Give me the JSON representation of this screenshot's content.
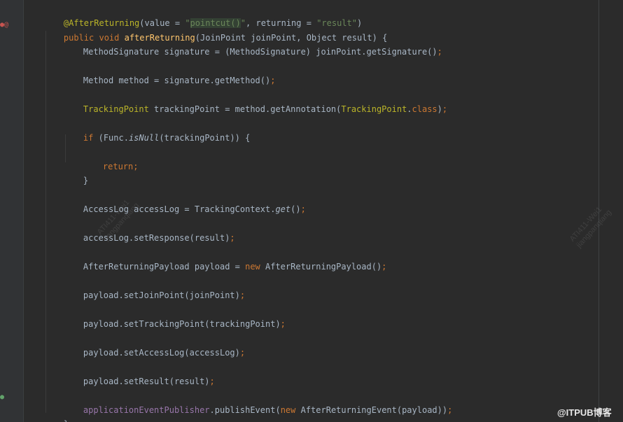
{
  "gutter": {
    "line2_icons": "●@",
    "line_last_icon": "●"
  },
  "code": {
    "l1": {
      "a": "@AfterReturning",
      "b": "(value = ",
      "c": "\"",
      "d": "pointcut()",
      "e": "\"",
      "f": ", returning = ",
      "g": "\"result\"",
      "h": ")"
    },
    "l2": {
      "a": "public ",
      "b": "void ",
      "c": "afterReturning",
      "d": "(JoinPoint joinPoint, Object result) {"
    },
    "l3": {
      "a": "MethodSignature signature = (MethodSignature) joinPoint.getSignature()",
      "b": ";"
    },
    "l4": {
      "a": "Method method = signature.getMethod()",
      "b": ";"
    },
    "l5": {
      "a": "TrackingPoint",
      "b": " trackingPoint = method.getAnnotation(",
      "c": "TrackingPoint",
      "d": ".",
      "e": "class",
      "f": ")",
      "g": ";"
    },
    "l6": {
      "a": "if ",
      "b": "(Func.",
      "c": "isNull",
      "d": "(trackingPoint)) {"
    },
    "l7": {
      "a": "return",
      "b": ";"
    },
    "l8": {
      "a": "}"
    },
    "l9": {
      "a": "AccessLog accessLog = TrackingContext.",
      "b": "get",
      "c": "()",
      "d": ";"
    },
    "l10": {
      "a": "accessLog.setResponse(result)",
      "b": ";"
    },
    "l11": {
      "a": "AfterReturningPayload payload = ",
      "b": "new ",
      "c": "AfterReturningPayload()",
      "d": ";"
    },
    "l12": {
      "a": "payload.setJoinPoint(joinPoint)",
      "b": ";"
    },
    "l13": {
      "a": "payload.setTrackingPoint(trackingPoint)",
      "b": ";"
    },
    "l14": {
      "a": "payload.setAccessLog(accessLog)",
      "b": ";"
    },
    "l15": {
      "a": "payload.setResult(result)",
      "b": ";"
    },
    "l16": {
      "a": "applicationEventPublisher",
      "b": ".publishEvent(",
      "c": "new ",
      "d": "AfterReturningEvent(payload))",
      "e": ";"
    },
    "l17": {
      "a": "}"
    }
  },
  "watermarks": {
    "w1": {
      "line1": "ATI411-Wei1",
      "line2": "jiangpanqiang"
    },
    "w2": {
      "line1": "ATI411-Wei1",
      "line2": "jiangpanqiang"
    }
  },
  "brand": "@ITPUB博客",
  "colors": {
    "background": "#2b2b2b",
    "keyword": "#cc7832",
    "annotation": "#bbb529",
    "string": "#6a8759",
    "function": "#ffc66d",
    "field": "#9876aa",
    "text": "#a9b7c6"
  }
}
